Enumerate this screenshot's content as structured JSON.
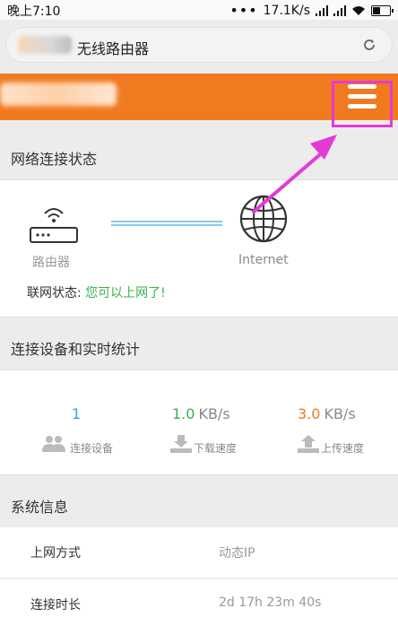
{
  "status_bar": {
    "time": "晚上7:10",
    "dots": "•••",
    "net_speed": "17.1K/s"
  },
  "browser": {
    "page_title": "无线路由器"
  },
  "connection_status": {
    "section_title": "网络连接状态",
    "router_label": "路由器",
    "internet_label": "Internet",
    "status_label": "联网状态:",
    "status_value": "您可以上网了!",
    "status_color": "#36b14c"
  },
  "devices_stats": {
    "section_title": "连接设备和实时统计",
    "connected": {
      "value": "1",
      "label": "连接设备",
      "color": "#2ea7d8"
    },
    "download": {
      "value": "1.0",
      "unit": "KB/s",
      "label": "下载速度",
      "color": "#36b14c"
    },
    "upload": {
      "value": "3.0",
      "unit": "KB/s",
      "label": "上传速度",
      "color": "#f07a1f"
    }
  },
  "system_info": {
    "section_title": "系统信息",
    "rows": [
      {
        "key": "上网方式",
        "value": "动态IP"
      },
      {
        "key": "连接时长",
        "value": "2d 17h 23m 40s"
      }
    ]
  },
  "icons": {
    "menu": "menu-icon",
    "reload": "reload-icon",
    "router": "router-icon",
    "globe": "globe-icon",
    "users": "users-icon",
    "download": "download-icon",
    "upload": "upload-icon"
  },
  "colors": {
    "header_orange": "#f07a1f",
    "annotation_magenta": "#e33ad6"
  }
}
